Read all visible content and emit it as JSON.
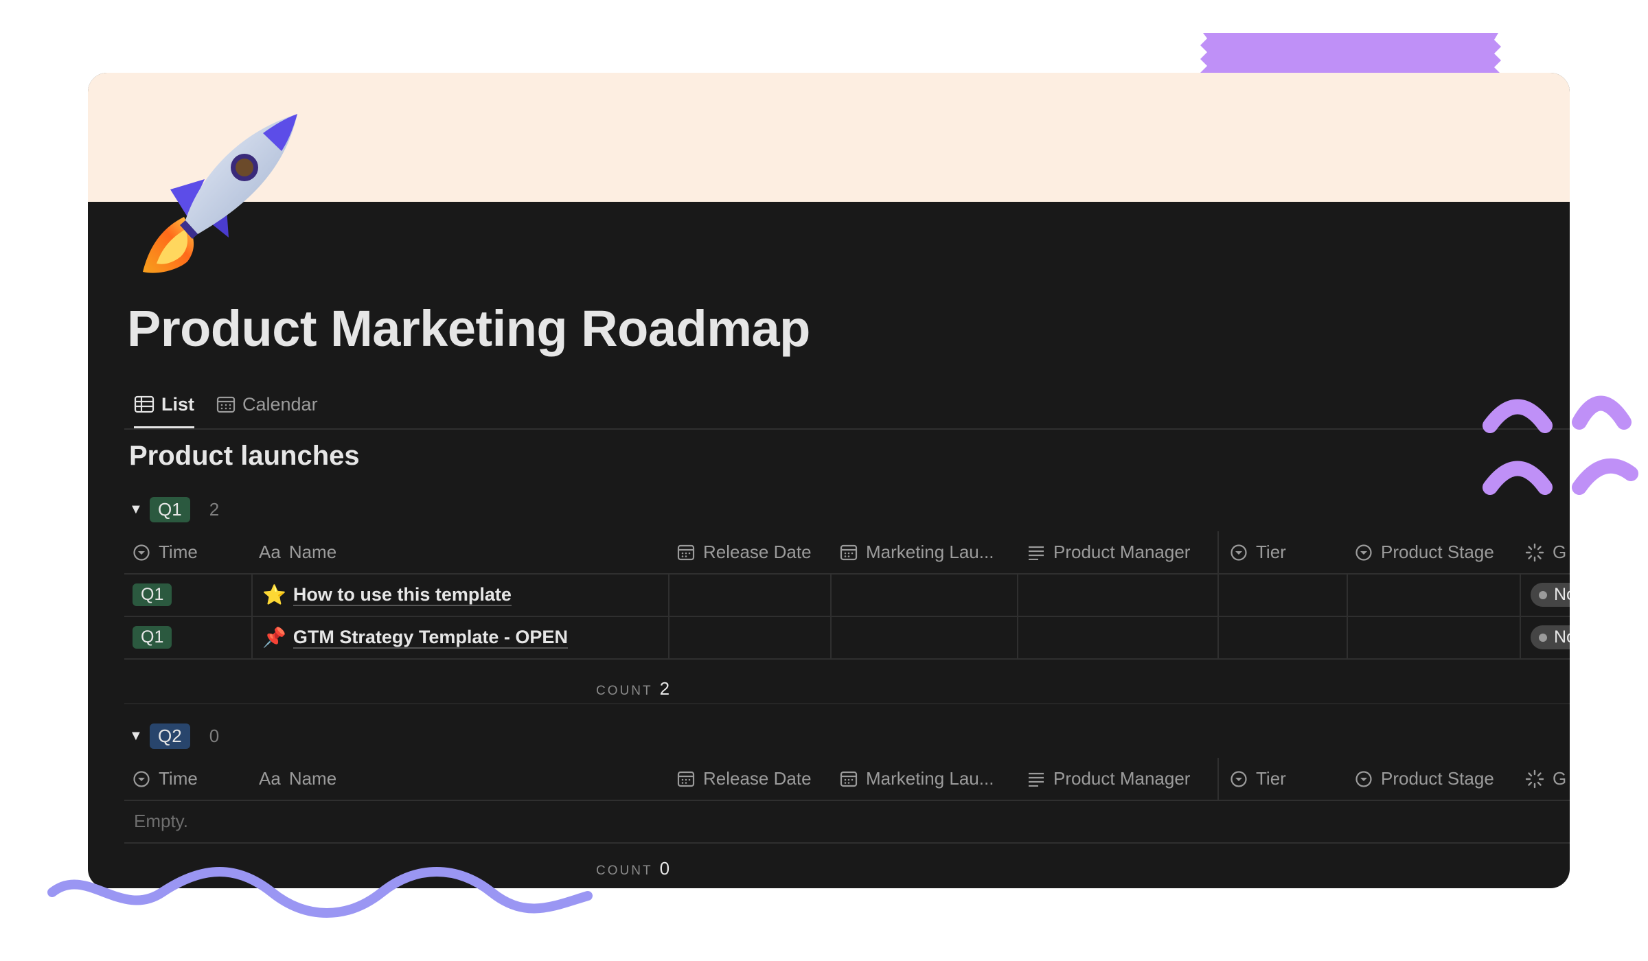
{
  "page": {
    "title": "Product Marketing Roadmap",
    "cover_color": "#fdeee1",
    "icon": "rocket-icon"
  },
  "tabs": [
    {
      "label": "List",
      "icon": "table-icon",
      "active": true
    },
    {
      "label": "Calendar",
      "icon": "calendar-icon",
      "active": false
    }
  ],
  "database": {
    "title": "Product launches",
    "columns": [
      {
        "label": "Time",
        "icon": "select-icon"
      },
      {
        "label": "Name",
        "icon": "Aa"
      },
      {
        "label": "Release Date",
        "icon": "date-icon"
      },
      {
        "label": "Marketing Lau...",
        "icon": "date-icon"
      },
      {
        "label": "Product Manager",
        "icon": "text-icon"
      },
      {
        "label": "Tier",
        "icon": "select-icon"
      },
      {
        "label": "Product Stage",
        "icon": "select-icon"
      },
      {
        "label": "G",
        "icon": "status-icon"
      }
    ],
    "groups": [
      {
        "tag": "Q1",
        "tag_color": "#2b593f",
        "count": "2",
        "rows": [
          {
            "time": "Q1",
            "emoji": "⭐",
            "name": "How to use this template",
            "status": "No"
          },
          {
            "time": "Q1",
            "emoji": "📌",
            "name": "GTM Strategy Template - OPEN",
            "status": "No"
          }
        ],
        "footer_label": "COUNT",
        "footer_value": "2"
      },
      {
        "tag": "Q2",
        "tag_color": "#28456c",
        "count": "0",
        "empty_text": "Empty.",
        "footer_label": "COUNT",
        "footer_value": "0"
      }
    ]
  },
  "colors": {
    "background": "#191919",
    "text": "#e6e6e6",
    "muted": "#9b9b9b",
    "accent_decor": "#bf90f7"
  }
}
